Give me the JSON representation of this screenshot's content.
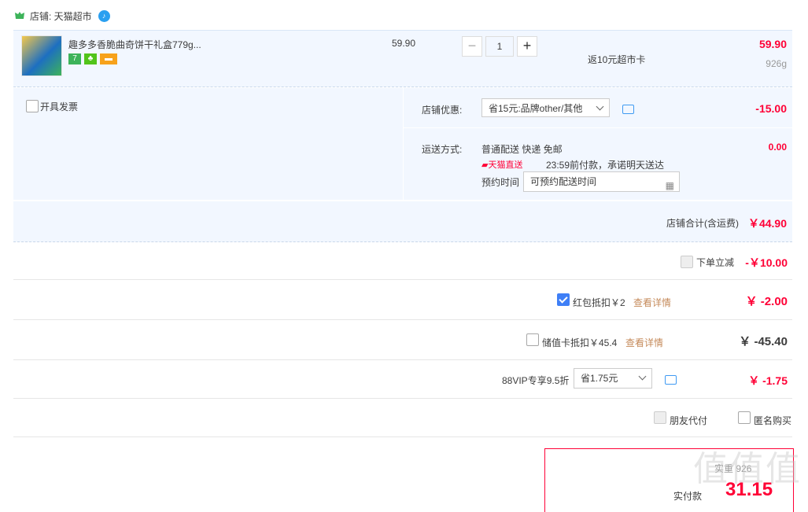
{
  "store": {
    "label": "店铺: 天猫超市"
  },
  "item": {
    "title": "趣多多香脆曲奇饼干礼盒779g...",
    "unit_price": "59.90",
    "qty": "1",
    "minus": "−",
    "plus": "+",
    "rebate": "返10元超市卡",
    "total": "59.90",
    "weight": "926g",
    "tags": [
      "7",
      "",
      ""
    ]
  },
  "invoice": {
    "label": "开具发票"
  },
  "shop_discount": {
    "label": "店铺优惠:",
    "selected": "省15元:品牌other/其他",
    "amount": "-15.00"
  },
  "shipping": {
    "label": "运送方式:",
    "method": "普通配送 快递 免邮",
    "badge": "天猫直送",
    "promise": "23:59前付款，承诺明天送达",
    "schedule_label": "预约时间",
    "schedule_value": "可预约配送时间",
    "amount": "0.00"
  },
  "store_total": {
    "label": "店铺合计(含运费)",
    "value": "￥44.90"
  },
  "instant_discount": {
    "label": "下单立减",
    "value": "-￥10.00"
  },
  "red_packet": {
    "label": "红包抵扣￥2",
    "link": "查看详情",
    "value": "￥ -2.00"
  },
  "stored_card": {
    "label": "储值卡抵扣￥45.4",
    "link": "查看详情",
    "value": "￥ -45.40"
  },
  "vip": {
    "label": "88VIP专享9.5折",
    "selected": "省1.75元",
    "value": "￥ -1.75"
  },
  "options": {
    "friend_pay": "朋友代付",
    "anonymous": "匿名购买"
  },
  "final": {
    "weight_label": "实重",
    "weight": "926",
    "pay_label": "实付款",
    "pay_value": "31.15"
  },
  "watermark": "值值值",
  "colors": {
    "accent": "#ff0036",
    "panel": "#f2f7ff",
    "link": "#c58a5a",
    "check": "#3f7ff6"
  }
}
